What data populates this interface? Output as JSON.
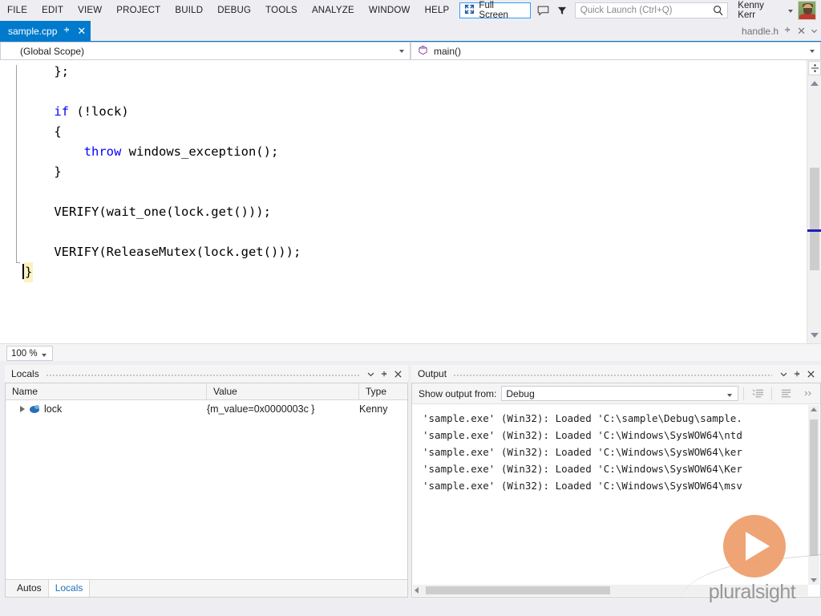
{
  "menu": {
    "items": [
      {
        "label": "FILE",
        "name": "menu-file"
      },
      {
        "label": "EDIT",
        "name": "menu-edit"
      },
      {
        "label": "VIEW",
        "name": "menu-view"
      },
      {
        "label": "PROJECT",
        "name": "menu-project"
      },
      {
        "label": "BUILD",
        "name": "menu-build"
      },
      {
        "label": "DEBUG",
        "name": "menu-debug"
      },
      {
        "label": "TOOLS",
        "name": "menu-tools"
      },
      {
        "label": "ANALYZE",
        "name": "menu-analyze"
      },
      {
        "label": "WINDOW",
        "name": "menu-window"
      },
      {
        "label": "HELP",
        "name": "menu-help"
      }
    ],
    "full_screen_label": "Full Screen",
    "full_screen_icon": "expand-arrows-icon",
    "feedback_icon": "speech-bubble-icon",
    "filter_icon": "funnel-icon",
    "user_name": "Kenny Kerr",
    "accent_color": "#007acc"
  },
  "search": {
    "placeholder": "Quick Launch (Ctrl+Q)",
    "value": "",
    "icon": "search-icon"
  },
  "tabs": {
    "active": {
      "label": "sample.cpp",
      "pin_icon": "pin-icon",
      "close_icon": "close-icon"
    },
    "inactive": {
      "label": "handle.h",
      "pin_icon": "pin-icon",
      "close_icon": "close-icon",
      "menu_icon": "chevron-down-icon"
    }
  },
  "navbar": {
    "scope": "(Global Scope)",
    "member": "main()",
    "member_icon": "method-icon"
  },
  "editor": {
    "zoom": "100 %",
    "lines": [
      {
        "segments": [
          {
            "t": "    };",
            "c": "plain"
          }
        ]
      },
      {
        "segments": [
          {
            "t": "",
            "c": "plain"
          }
        ]
      },
      {
        "segments": [
          {
            "t": "    ",
            "c": "plain"
          },
          {
            "t": "if",
            "c": "kw"
          },
          {
            "t": " (!lock)",
            "c": "plain"
          }
        ]
      },
      {
        "segments": [
          {
            "t": "    {",
            "c": "plain"
          }
        ]
      },
      {
        "segments": [
          {
            "t": "        ",
            "c": "plain"
          },
          {
            "t": "throw",
            "c": "kw"
          },
          {
            "t": " windows_exception();",
            "c": "plain"
          }
        ]
      },
      {
        "segments": [
          {
            "t": "    }",
            "c": "plain"
          }
        ]
      },
      {
        "segments": [
          {
            "t": "",
            "c": "plain"
          }
        ]
      },
      {
        "segments": [
          {
            "t": "    VERIFY(wait_one(lock.get()));",
            "c": "plain"
          }
        ]
      },
      {
        "segments": [
          {
            "t": "",
            "c": "plain"
          }
        ]
      },
      {
        "segments": [
          {
            "t": "    VERIFY(ReleaseMutex(lock.get()));",
            "c": "plain"
          }
        ]
      },
      {
        "segments": [
          {
            "t": "}",
            "c": "highlight"
          }
        ]
      }
    ]
  },
  "locals": {
    "title": "Locals",
    "columns": [
      "Name",
      "Value",
      "Type"
    ],
    "rows": [
      {
        "name": "lock",
        "value": "{m_value=0x0000003c }",
        "type": "Kenny",
        "icon": "object-icon",
        "expander": "expand-triangle-icon"
      }
    ],
    "tabs": [
      {
        "label": "Autos",
        "selected": false
      },
      {
        "label": "Locals",
        "selected": true
      }
    ],
    "header_buttons": [
      {
        "name": "panel-dropdown-button",
        "icon": "chevron-down-icon"
      },
      {
        "name": "panel-pin-button",
        "icon": "pin-icon"
      },
      {
        "name": "panel-close-button",
        "icon": "close-icon"
      }
    ]
  },
  "output": {
    "title": "Output",
    "source_label": "Show output from:",
    "source_value": "Debug",
    "toolbar_icons": [
      "find-message-icon",
      "clear-all-icon",
      "overflow-chevron-icon"
    ],
    "lines": [
      "'sample.exe' (Win32): Loaded 'C:\\sample\\Debug\\sample.",
      "'sample.exe' (Win32): Loaded 'C:\\Windows\\SysWOW64\\ntd",
      "'sample.exe' (Win32): Loaded 'C:\\Windows\\SysWOW64\\ker",
      "'sample.exe' (Win32): Loaded 'C:\\Windows\\SysWOW64\\Ker",
      "'sample.exe' (Win32): Loaded 'C:\\Windows\\SysWOW64\\msv"
    ],
    "header_buttons": [
      {
        "name": "panel-dropdown-button",
        "icon": "chevron-down-icon"
      },
      {
        "name": "panel-pin-button",
        "icon": "pin-icon"
      },
      {
        "name": "panel-close-button",
        "icon": "close-icon"
      }
    ]
  },
  "watermark": {
    "text": "pluralsight",
    "icon": "play-button-icon",
    "color": "#ee9d6a"
  }
}
